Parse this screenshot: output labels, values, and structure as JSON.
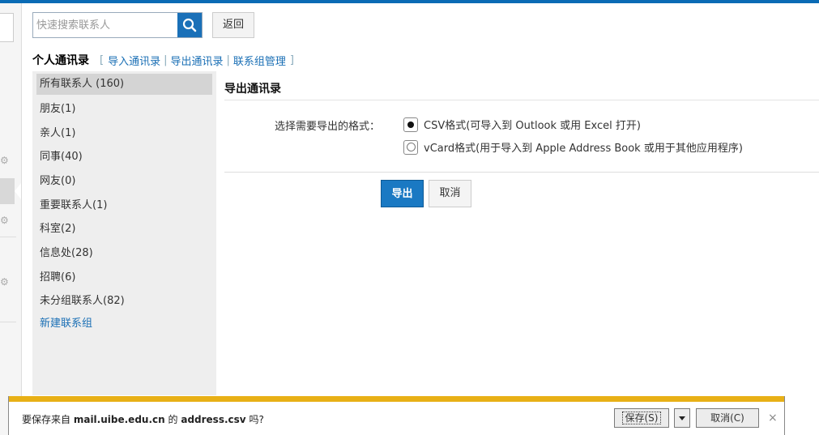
{
  "colors": {
    "accent": "#1a79c3",
    "link": "#1a6fb5",
    "download_stripe": "#e8b016"
  },
  "search": {
    "placeholder": "快速搜索联系人",
    "value": "",
    "icon": "search-icon"
  },
  "back_label": "返回",
  "header": {
    "title": "个人通讯录",
    "bracket_open": "[",
    "bracket_close": "]",
    "links": [
      "导入通讯录",
      "导出通讯录",
      "联系组管理"
    ],
    "separator": "|"
  },
  "groups": {
    "items": [
      "所有联系人 (160)",
      "朋友(1)",
      "亲人(1)",
      "同事(40)",
      "网友(0)",
      "重要联系人(1)",
      "科室(2)",
      "信息处(28)",
      "招聘(6)",
      "未分组联系人(82)"
    ],
    "selected": "所有联系人 (160)",
    "new_group": "新建联系组"
  },
  "export": {
    "title": "导出通讯录",
    "format_label": "选择需要导出的格式：",
    "options": [
      {
        "label": "CSV格式(可导入到 Outlook 或用 Excel 打开)",
        "selected": true
      },
      {
        "label": "vCard格式(用于导入到 Apple Address Book 或用于其他应用程序)",
        "selected": false
      }
    ],
    "export_button": "导出",
    "cancel_button": "取消"
  },
  "download_bar": {
    "prefix": "要保存来自",
    "site": "mail.uibe.edu.cn",
    "middle": "的",
    "file": "address.csv",
    "suffix": "吗?",
    "save_label": "保存(S)",
    "cancel_label": "取消(C)",
    "close_symbol": "×"
  }
}
